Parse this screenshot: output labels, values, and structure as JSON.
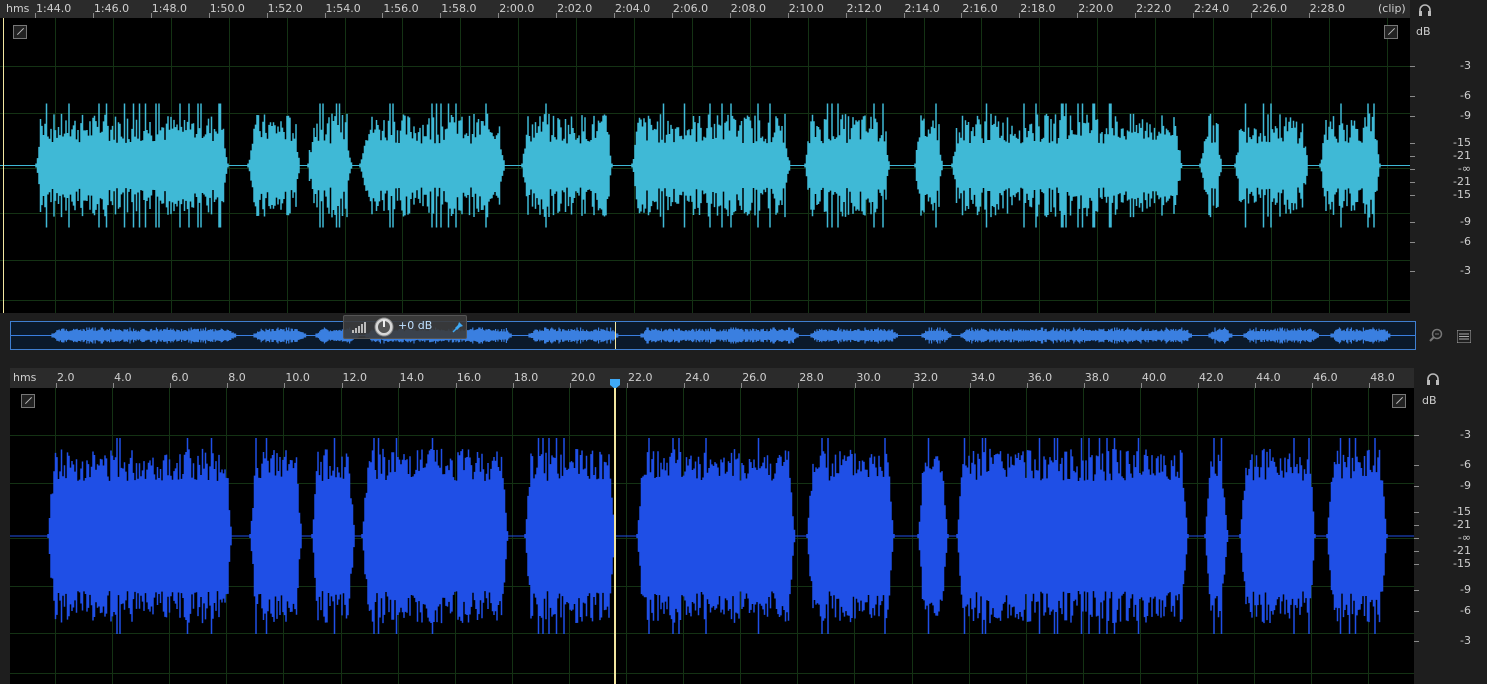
{
  "top_ruler": {
    "unit": "hms",
    "end_label": "(clip)",
    "ticks": [
      "1:44.0",
      "1:46.0",
      "1:48.0",
      "1:50.0",
      "1:52.0",
      "1:54.0",
      "1:56.0",
      "1:58.0",
      "2:00.0",
      "2:02.0",
      "2:04.0",
      "2:06.0",
      "2:08.0",
      "2:10.0",
      "2:12.0",
      "2:14.0",
      "2:16.0",
      "2:18.0",
      "2:20.0",
      "2:22.0",
      "2:24.0",
      "2:26.0",
      "2:28.0"
    ]
  },
  "db_scale": {
    "unit": "dB",
    "labels": [
      "-3",
      "-6",
      "-9",
      "-15",
      "-21",
      "-∞",
      "-21",
      "-15",
      "-9",
      "-6",
      "-3"
    ]
  },
  "bottom_ruler": {
    "unit": "hms",
    "ticks": [
      "2.0",
      "4.0",
      "6.0",
      "8.0",
      "10.0",
      "12.0",
      "14.0",
      "16.0",
      "18.0",
      "20.0",
      "22.0",
      "24.0",
      "26.0",
      "28.0",
      "30.0",
      "32.0",
      "34.0",
      "36.0",
      "38.0",
      "40.0",
      "42.0",
      "44.0",
      "46.0",
      "48.0"
    ]
  },
  "hud": {
    "gain_label": "+0 dB"
  },
  "colors": {
    "top_waveform": "#3fb9d6",
    "bottom_waveform": "#1f4fe6",
    "overview_waveform": "#3a7fe0",
    "playhead": "#f2e6a0",
    "grid": "#143214"
  },
  "icons": {
    "headphones": "headphones-icon",
    "zoom": "zoom-icon",
    "menu": "menu-icon",
    "pin": "pin-icon",
    "knob": "knob-icon",
    "meter": "level-meter-icon"
  }
}
